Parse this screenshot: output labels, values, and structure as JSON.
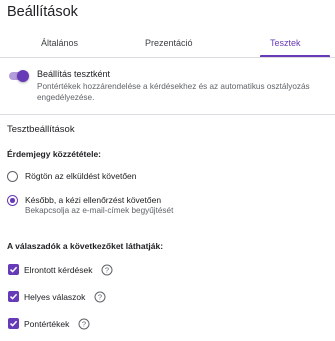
{
  "header": {
    "title": "Beállítások"
  },
  "tabs": [
    {
      "label": "Általános"
    },
    {
      "label": "Prezentáció"
    },
    {
      "label": "Tesztek"
    }
  ],
  "quiz_toggle": {
    "label": "Beállítás tesztként",
    "description": "Pontértékek hozzárendelése a kérdésekhez és az automatikus osztályozás engedélyezése.",
    "enabled": true
  },
  "quiz_settings": {
    "title": "Tesztbeállítások",
    "release_grade": {
      "heading": "Érdemjegy közzététele:",
      "options": [
        {
          "label": "Rögtön az elküldést követően",
          "sub": ""
        },
        {
          "label": "Később, a kézi ellenőrzést követően",
          "sub": "Bekapcsolja az e-mail-címek begyűjtését"
        }
      ],
      "selected_label": "Később, a kézi ellenőrzést követően"
    },
    "respondent_can_see": {
      "heading": "A válaszadók a következőket láthatják:",
      "items": [
        {
          "label": "Elrontott kérdések",
          "checked": true
        },
        {
          "label": "Helyes válaszok",
          "checked": true
        },
        {
          "label": "Pontértékek",
          "checked": true
        }
      ]
    }
  },
  "colors": {
    "accent": "#673ab7",
    "accent_light": "#b39ddb",
    "divider": "#dadce0",
    "secondary_text": "#5f6368"
  },
  "icons": {
    "help": "help-circle-icon",
    "check": "check-icon"
  }
}
